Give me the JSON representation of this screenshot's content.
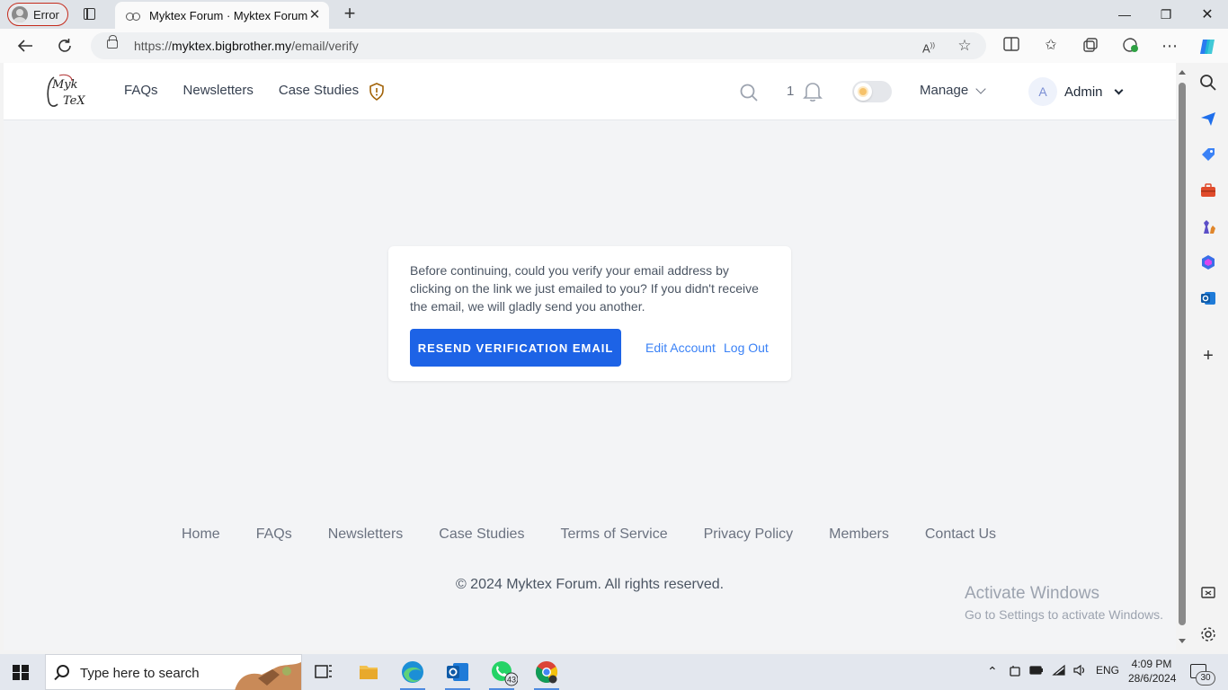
{
  "browser": {
    "profile_label": "Error",
    "tab_title": "Myktex Forum · Myktex Forum",
    "url_prefix": "https://",
    "url_domain": "myktex.bigbrother.my",
    "url_path": "/email/verify"
  },
  "site": {
    "logo_text_line1": "Myk",
    "logo_text_line2": "TeX",
    "nav": [
      "FAQs",
      "Newsletters",
      "Case Studies"
    ],
    "notification_count": "1",
    "manage_label": "Manage",
    "user_initial": "A",
    "user_name": "Admin"
  },
  "verify": {
    "message": "Before continuing, could you verify your email address by clicking on the link we just emailed to you? If you didn't receive the email, we will gladly send you another.",
    "resend_label": "RESEND VERIFICATION EMAIL",
    "edit_account_label": "Edit Account",
    "logout_label": "Log Out"
  },
  "footer": {
    "links": [
      "Home",
      "FAQs",
      "Newsletters",
      "Case Studies",
      "Terms of Service",
      "Privacy Policy",
      "Members",
      "Contact Us"
    ],
    "copyright": "© 2024 Myktex Forum. All rights reserved."
  },
  "watermark": {
    "title": "Activate Windows",
    "subtitle": "Go to Settings to activate Windows."
  },
  "taskbar": {
    "search_placeholder": "Type here to search",
    "whatsapp_badge": "43",
    "language": "ENG",
    "time": "4:09 PM",
    "date": "28/6/2024",
    "notification_badge": "30"
  },
  "colors": {
    "primary_button": "#1d63e6",
    "link": "#3b82f6",
    "error_outline": "#c42b1c"
  }
}
